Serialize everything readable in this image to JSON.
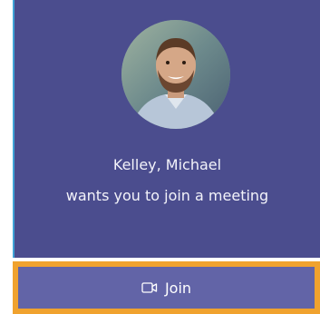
{
  "incoming_call": {
    "caller_name": "Kelley, Michael",
    "message": "wants you to join a meeting",
    "avatar_icon": "avatar-photo",
    "join_label": "Join",
    "join_icon": "video-camera-icon"
  },
  "colors": {
    "card_background": "#4b4d8e",
    "join_background": "#6264a7",
    "focus_outline": "#f0a22e",
    "left_accent": "#3fa3d6",
    "text": "#ffffff"
  }
}
